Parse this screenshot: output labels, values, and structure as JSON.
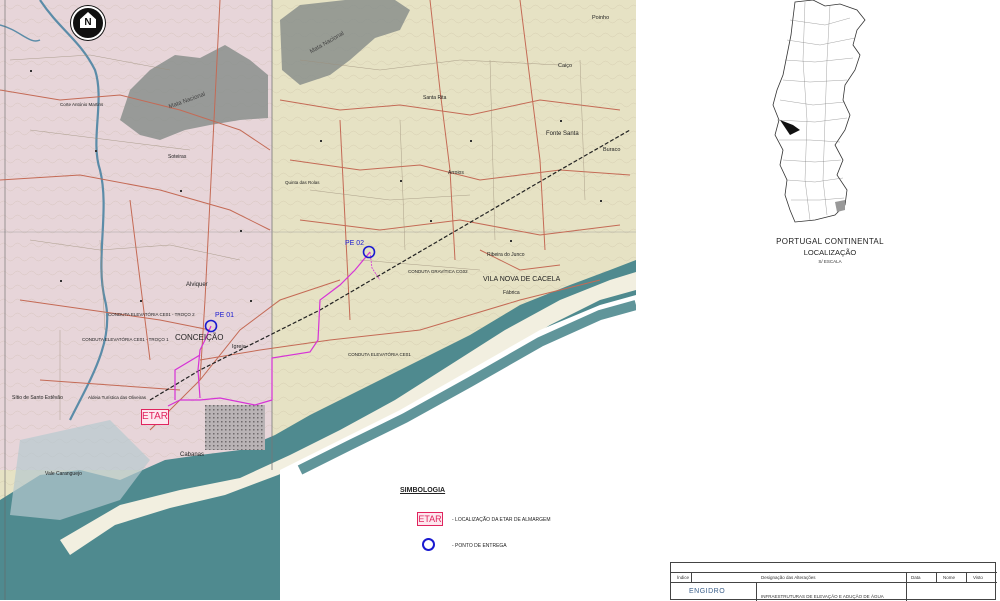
{
  "north_arrow": {
    "label": "N"
  },
  "map": {
    "features": [
      {
        "name": "Mata Nacional",
        "type": "forest"
      },
      {
        "name": "Mata Nacional",
        "type": "forest"
      },
      {
        "name": "Ria Formosa",
        "type": "water"
      }
    ],
    "towns": {
      "conceicao": "CONCEIÇÃO",
      "vila_nova_cacela": "VILA NOVA DE CACELA",
      "cabanas": "Cabanas",
      "alviquer": "Alviquer",
      "igreja": "Igreja",
      "santo_estevao": "Sítio de Santo Estêvão",
      "fonte_santa": "Fonte Santa",
      "poinho": "Poinho",
      "caico": "Caiço",
      "buraco": "Buraco",
      "santa_rita": "Santa Rita",
      "fabrica": "Fábrica",
      "soteiras": "Soteiras",
      "corte_antonio_martins": "Corte António Martins",
      "vale_caranguejo": "Vale Caranguejo",
      "aldeia_turistica": "Aldeia Turística das Oliveiras",
      "quinta_das_rolas": "Quinta das Rolas",
      "arroios": "Arroios",
      "ribeira_do_junco": "Ribeira do Junco"
    },
    "pipelines": {
      "ce01_t2": "CONDUTA ELEVATÓRIA CE01 - TROÇO 2",
      "ce01_t1": "CONDUTA ELEVATÓRIA CE01 - TROÇO 1",
      "ce01": "CONDUTA ELEVATÓRIA CE01",
      "cg02": "CONDUTA GRAVÍTICA CG02"
    },
    "delivery_points": [
      {
        "label": "PE 01"
      },
      {
        "label": "PE 02"
      }
    ],
    "etar_label": "ETAR"
  },
  "legend": {
    "title": "SIMBOLOGIA",
    "items": [
      {
        "symbol": "ETAR",
        "text": "- LOCALIZAÇÃO DA ETAR DE ALMARGEM"
      },
      {
        "symbol": "circle",
        "text": "- PONTO DE ENTREGA"
      }
    ]
  },
  "location_map": {
    "title": "PORTUGAL CONTINENTAL",
    "subtitle": "LOCALIZAÇÃO",
    "scale": "S/ ESCALA"
  },
  "title_block": {
    "company": "ENGIDRO",
    "project": "INFRAESTRUTURAS DE ELEVAÇÃO E ADUÇÃO DE ÁGUA",
    "fields": [
      "Índice",
      "Designação das Alterações",
      "Data",
      "Nome",
      "Visto"
    ]
  },
  "colors": {
    "land": "#e6e2c4",
    "urban_pink": "#e7d5d9",
    "sea": "#4f8a8f",
    "sand": "#f2efe0",
    "roads": "#c46a55",
    "pipeline": "#d633d6",
    "etar": "#e0245e",
    "delivery_point": "#1a1ad0",
    "forest": "#8a8f8c"
  }
}
